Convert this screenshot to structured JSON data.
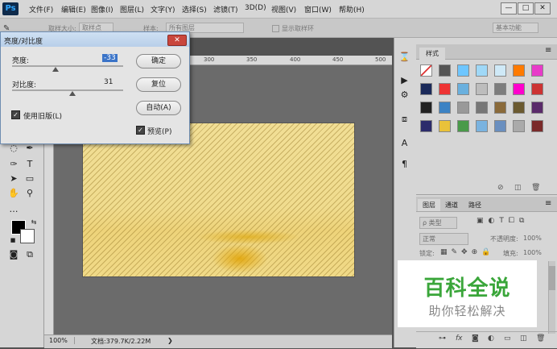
{
  "app": {
    "logo": "Ps"
  },
  "menubar": {
    "items": [
      "文件(F)",
      "编辑(E)",
      "图像(I)",
      "图层(L)",
      "文字(Y)",
      "选择(S)",
      "滤镜(T)",
      "3D(D)",
      "视图(V)",
      "窗口(W)",
      "帮助(H)"
    ]
  },
  "window_controls": {
    "minimize": "—",
    "restore": "□",
    "close": "✕"
  },
  "options_bar": {
    "sample_size_label": "取样大小:",
    "sample_size_value": "取样点",
    "sample_label": "样本:",
    "sample_value": "所有图层",
    "show_ring": "显示取样环",
    "workspace": "基本功能"
  },
  "ruler": {
    "marks": [
      "300",
      "350",
      "400",
      "450",
      "500"
    ]
  },
  "dialog": {
    "title": "亮度/对比度",
    "brightness_label": "亮度:",
    "brightness_value": "-33",
    "brightness_level": -33,
    "contrast_label": "对比度:",
    "contrast_value": "31",
    "contrast_level": 31,
    "ok": "确定",
    "reset": "复位",
    "auto": "自动(A)",
    "use_legacy": "使用旧版(L)",
    "preview": "预览(P)"
  },
  "status": {
    "zoom": "100%",
    "doc": "文档:379.7K/2.22M"
  },
  "styles_panel": {
    "tab": "样式"
  },
  "layers_panel": {
    "tabs": [
      "图层",
      "通道",
      "路径"
    ],
    "kind": "ρ 类型",
    "blend_mode": "正常",
    "opacity_label": "不透明度:",
    "opacity_value": "100%",
    "lock_label": "锁定:",
    "fill_label": "填充:",
    "fill_value": "100%"
  },
  "watermark": {
    "title": "百科全说",
    "subtitle": "助你轻松解决"
  },
  "colors": {
    "accent_blue": "#31a8ff",
    "watermark_green": "#3aa63a",
    "title_bar": "#b8cfe9"
  }
}
